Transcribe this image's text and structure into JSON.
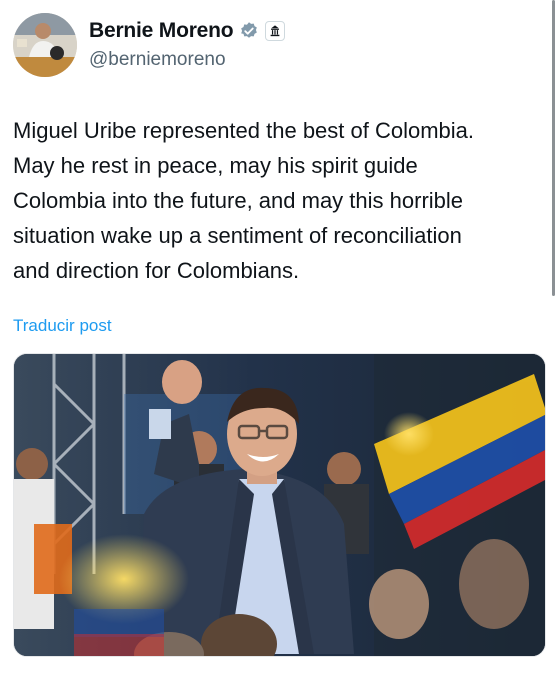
{
  "author": {
    "name": "Bernie Moreno",
    "handle": "@berniemoreno",
    "avatar_icon": "profile-photo",
    "verified_icon": "verified-badge-icon",
    "affiliation_icon": "government-building-icon"
  },
  "tweet": {
    "text": "Miguel Uribe represented the best of Colombia.\nMay he rest in peace, may his spirit guide\nColombia into the future, and may this horrible\nsituation wake up a sentiment of reconciliation\nand direction for Colombians.",
    "translate_label": "Traducir post"
  },
  "media": {
    "type": "photo"
  },
  "colors": {
    "link": "#1d9bf0",
    "verified": "#829aab",
    "secondary_text": "#536471"
  }
}
